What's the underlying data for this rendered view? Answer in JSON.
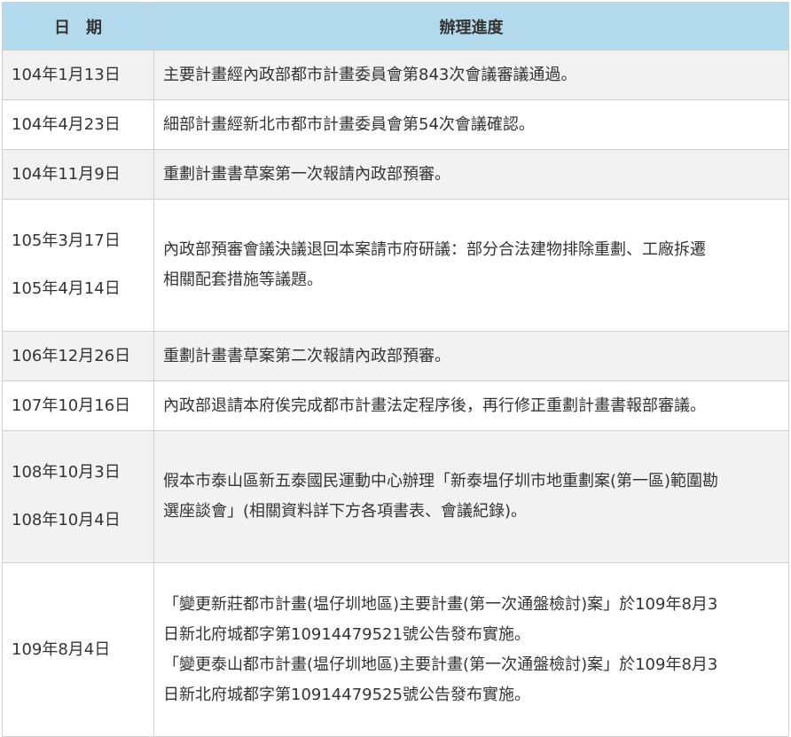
{
  "table": {
    "headers": {
      "date": "日　期",
      "progress": "辦理進度"
    },
    "rows": [
      {
        "dates": [
          "104年1月13日"
        ],
        "lines": [
          "主要計畫經內政部都市計畫委員會第843次會議審議通過。"
        ]
      },
      {
        "dates": [
          "104年4月23日"
        ],
        "lines": [
          "細部計畫經新北市都市計畫委員會第54次會議確認。"
        ]
      },
      {
        "dates": [
          "104年11月9日"
        ],
        "lines": [
          "重劃計畫書草案第一次報請內政部預審。"
        ]
      },
      {
        "dates": [
          "105年3月17日",
          "105年4月14日"
        ],
        "lines": [
          "內政部預審會議決議退回本案請市府研議：部分合法建物排除重劃、工廠拆遷",
          "相關配套措施等議題。"
        ]
      },
      {
        "dates": [
          "106年12月26日"
        ],
        "lines": [
          "重劃計畫書草案第二次報請內政部預審。"
        ]
      },
      {
        "dates": [
          "107年10月16日"
        ],
        "lines": [
          "內政部退請本府俟完成都市計畫法定程序後，再行修正重劃計畫書報部審議。"
        ]
      },
      {
        "dates": [
          "108年10月3日",
          "108年10月4日"
        ],
        "lines": [
          "假本市泰山區新五泰國民運動中心辦理「新泰塭仔圳市地重劃案(第一區)範圍勘",
          "選座談會」(相關資料詳下方各項書表、會議紀錄)。"
        ]
      },
      {
        "dates": [
          "109年8月4日"
        ],
        "lines": [
          "「變更新莊都市計畫(塭仔圳地區)主要計畫(第一次通盤檢討)案」於109年8月3",
          "日新北府城都字第10914479521號公告發布實施。",
          "「變更泰山都市計畫(塭仔圳地區)主要計畫(第一次通盤檢討)案」於109年8月3",
          "日新北府城都字第10914479525號公告發布實施。"
        ]
      }
    ]
  }
}
